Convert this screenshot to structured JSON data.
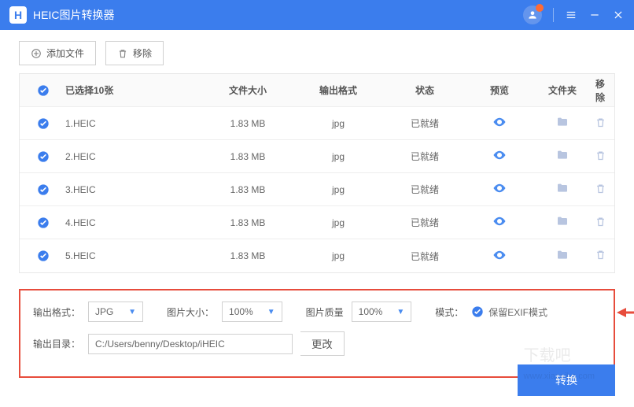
{
  "app": {
    "icon_letter": "H",
    "title": "HEIC图片转换器"
  },
  "toolbar": {
    "add_file": "添加文件",
    "remove": "移除"
  },
  "table": {
    "header": {
      "selected": "已选择10张",
      "size": "文件大小",
      "format": "输出格式",
      "status": "状态",
      "preview": "预览",
      "folder": "文件夹",
      "remove": "移除"
    },
    "rows": [
      {
        "name": "1.HEIC",
        "size": "1.83 MB",
        "format": "jpg",
        "status": "已就绪"
      },
      {
        "name": "2.HEIC",
        "size": "1.83 MB",
        "format": "jpg",
        "status": "已就绪"
      },
      {
        "name": "3.HEIC",
        "size": "1.83 MB",
        "format": "jpg",
        "status": "已就绪"
      },
      {
        "name": "4.HEIC",
        "size": "1.83 MB",
        "format": "jpg",
        "status": "已就绪"
      },
      {
        "name": "5.HEIC",
        "size": "1.83 MB",
        "format": "jpg",
        "status": "已就绪"
      }
    ]
  },
  "settings": {
    "format_label": "输出格式：",
    "format_value": "JPG",
    "size_label": "图片大小：",
    "size_value": "100%",
    "quality_label": "图片质量",
    "quality_value": "100%",
    "mode_label": "模式：",
    "mode_value": "保留EXIF模式",
    "outdir_label": "输出目录：",
    "outdir_value": "C:/Users/benny/Desktop/iHEIC",
    "change_btn": "更改"
  },
  "convert_btn": "转换",
  "colors": {
    "primary": "#3b7ded",
    "highlight": "#e74c3c"
  }
}
